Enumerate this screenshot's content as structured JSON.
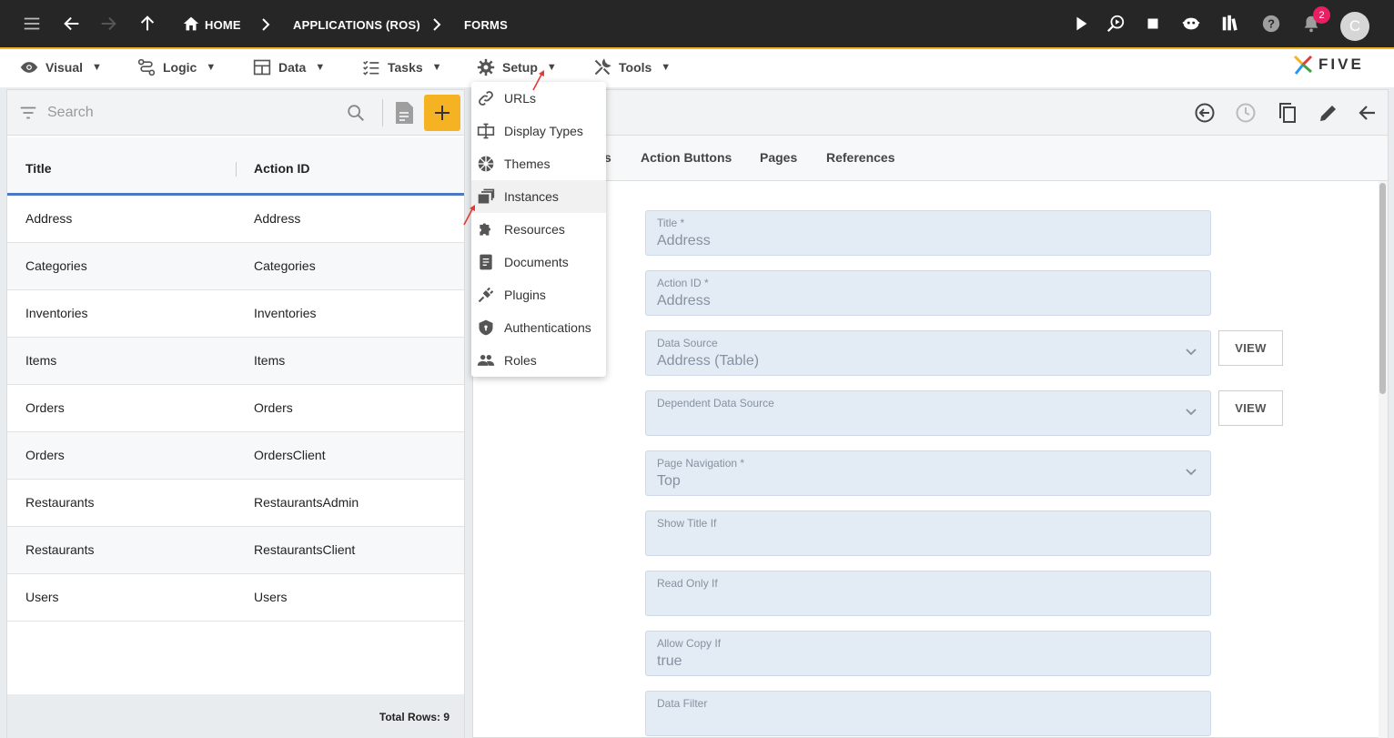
{
  "topbar": {
    "breadcrumbs": [
      "HOME",
      "APPLICATIONS (ROS)",
      "FORMS"
    ],
    "notification_count": "2",
    "avatar_initial": "C",
    "accent": "#f5b324",
    "badge_color": "#e91e63"
  },
  "menubar": {
    "items": [
      {
        "label": "Visual",
        "icon": "eye-icon"
      },
      {
        "label": "Logic",
        "icon": "logic-icon"
      },
      {
        "label": "Data",
        "icon": "table-icon"
      },
      {
        "label": "Tasks",
        "icon": "tasks-icon"
      },
      {
        "label": "Setup",
        "icon": "gear-icon"
      },
      {
        "label": "Tools",
        "icon": "tools-icon"
      }
    ],
    "arrow": "▼",
    "logo_text": "FIVE"
  },
  "setup_menu": {
    "items": [
      {
        "label": "URLs",
        "icon": "link-icon"
      },
      {
        "label": "Display Types",
        "icon": "display-type-icon"
      },
      {
        "label": "Themes",
        "icon": "themes-icon"
      },
      {
        "label": "Instances",
        "icon": "instances-icon"
      },
      {
        "label": "Resources",
        "icon": "puzzle-icon"
      },
      {
        "label": "Documents",
        "icon": "document-icon"
      },
      {
        "label": "Plugins",
        "icon": "plug-icon"
      },
      {
        "label": "Authentications",
        "icon": "shield-icon"
      },
      {
        "label": "Roles",
        "icon": "people-icon"
      }
    ],
    "highlighted": "Instances"
  },
  "list": {
    "search_placeholder": "Search",
    "add_label": "+",
    "columns": [
      "Title",
      "Action ID"
    ],
    "rows": [
      [
        "Address",
        "Address"
      ],
      [
        "Categories",
        "Categories"
      ],
      [
        "Inventories",
        "Inventories"
      ],
      [
        "Items",
        "Items"
      ],
      [
        "Orders",
        "Orders"
      ],
      [
        "Orders",
        "OrdersClient"
      ],
      [
        "Restaurants",
        "RestaurantsAdmin"
      ],
      [
        "Restaurants",
        "RestaurantsClient"
      ],
      [
        "Users",
        "Users"
      ]
    ],
    "total_rows": "Total Rows: 9"
  },
  "detail": {
    "tabs": [
      "s",
      "Action Buttons",
      "Pages",
      "References"
    ],
    "view_label": "VIEW",
    "fields": [
      {
        "label": "Title *",
        "value": "Address"
      },
      {
        "label": "Action ID *",
        "value": "Address"
      },
      {
        "label": "Data Source",
        "value": "Address (Table)"
      },
      {
        "label": "Dependent Data Source",
        "value": ""
      },
      {
        "label": "Page Navigation *",
        "value": "Top"
      },
      {
        "label": "Show Title If",
        "value": ""
      },
      {
        "label": "Read Only If",
        "value": ""
      },
      {
        "label": "Allow Copy If",
        "value": "true"
      },
      {
        "label": "Data Filter",
        "value": ""
      }
    ]
  }
}
